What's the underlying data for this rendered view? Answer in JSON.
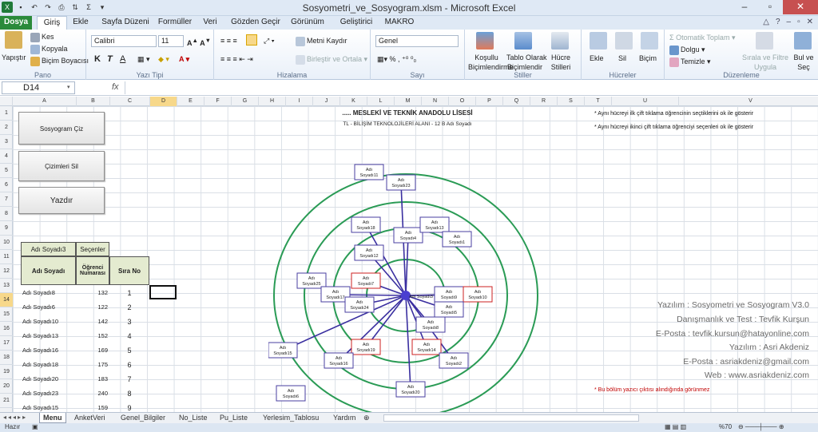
{
  "window": {
    "title": "Sosyometri_ve_Sosyogram.xlsm - Microsoft Excel"
  },
  "ribbon_tabs": [
    "Dosya",
    "Giriş",
    "Ekle",
    "Sayfa Düzeni",
    "Formüller",
    "Veri",
    "Gözden Geçir",
    "Görünüm",
    "Geliştirici",
    "MAKRO"
  ],
  "ribbon": {
    "pano": {
      "label": "Pano",
      "yapistir": "Yapıştır",
      "kes": "Kes",
      "kopyala": "Kopyala",
      "bicim_boyacisi": "Biçim Boyacısı"
    },
    "yazi_tipi": {
      "label": "Yazı Tipi",
      "font": "Calibri",
      "size": "11",
      "bold": "K",
      "italic": "T",
      "underline": "A"
    },
    "hizalama": {
      "label": "Hizalama",
      "metni_kaydir": "Metni Kaydır",
      "birlestir": "Birleştir ve Ortala"
    },
    "sayi": {
      "label": "Sayı",
      "format": "Genel"
    },
    "stiller": {
      "label": "Stiller",
      "kosullu": "Koşullu",
      "kosullu2": "Biçimlendirme",
      "tablo": "Tablo Olarak",
      "tablo2": "Biçimlendir",
      "hucre": "Hücre",
      "hucre2": "Stilleri"
    },
    "hucreler": {
      "label": "Hücreler",
      "ekle": "Ekle",
      "sil": "Sil",
      "bicim": "Biçim"
    },
    "duzenleme": {
      "label": "Düzenleme",
      "otomatik_toplam": "Otomatik Toplam",
      "dolgu": "Dolgu",
      "temizle": "Temizle",
      "sirala": "Sırala ve Filtre",
      "sirala2": "Uygula",
      "bul": "Bul ve",
      "bul2": "Seç"
    }
  },
  "formula_bar": {
    "name_box": "D14",
    "fx": "fx",
    "value": ""
  },
  "columns": [
    "A",
    "B",
    "C",
    "D",
    "E",
    "F",
    "G",
    "H",
    "I",
    "J",
    "K",
    "L",
    "M",
    "N",
    "O",
    "P",
    "Q",
    "R",
    "S",
    "T",
    "U",
    "V"
  ],
  "rows": [
    "1",
    "2",
    "3",
    "4",
    "5",
    "6",
    "7",
    "8",
    "9",
    "10",
    "11",
    "12",
    "13",
    "14",
    "15",
    "16",
    "17",
    "18",
    "19",
    "20",
    "21",
    "22"
  ],
  "macro_buttons": {
    "draw": "Sosyogram Çiz",
    "clear": "Çizimleri Sil",
    "print": "Yazdır"
  },
  "table": {
    "selected_label": "Adı Soyadı3",
    "choosers_label": "Seçenler",
    "headers": {
      "name": "Adı Soyadı",
      "number": "Öğrenci Numarası",
      "order": "Sıra No"
    },
    "rows": [
      {
        "name": "Adı Soyadı8",
        "number": "132",
        "order": "1"
      },
      {
        "name": "Adı Soyadı6",
        "number": "122",
        "order": "2"
      },
      {
        "name": "Adı Soyadı10",
        "number": "142",
        "order": "3"
      },
      {
        "name": "Adı Soyadı13",
        "number": "152",
        "order": "4"
      },
      {
        "name": "Adı Soyadı16",
        "number": "169",
        "order": "5"
      },
      {
        "name": "Adı Soyadı18",
        "number": "175",
        "order": "6"
      },
      {
        "name": "Adı Soyadı20",
        "number": "183",
        "order": "7"
      },
      {
        "name": "Adı Soyadı23",
        "number": "240",
        "order": "8"
      },
      {
        "name": "Adı Soyadı15",
        "number": "159",
        "order": "9"
      }
    ]
  },
  "sociogram": {
    "title": "..... MESLEKİ VE TEKNİK ANADOLU LİSESİ",
    "subtitle": "TL - BİLİŞİM TEKNOLOJİLERİ ALANI - 12 B  Adı Soyadı",
    "center": "Adı Soyadı3",
    "nodes": [
      "Adı Soyadı11",
      "Adı Soyadı23",
      "Adı Soyadı18",
      "Adı Soyadı4",
      "Adı Soyadı13",
      "Adı Soyadı1",
      "Adı Soyadı12",
      "Adı Soyadı7",
      "Adı Soyadı25",
      "Adı Soyadı17",
      "Adı Soyadı24",
      "Adı Soyadı9",
      "Adı Soyadı10",
      "Adı Soyadı5",
      "Adı Soyadı8",
      "Adı Soyadı19",
      "Adı Soyadı14",
      "Adı Soyadı15",
      "Adı Soyadı16",
      "Adı Soyadı2",
      "Adı Soyadı20",
      "Adı Soyadı6",
      "Adı Soyadı21",
      "Adı Soyadı22",
      "Adı Soyadı"
    ],
    "ring_color": "#2a9b55",
    "line_color": "#3a2fa0"
  },
  "notes": {
    "n1": "* Aynı hücreyi ilk çift tıklama öğrencinin seçtiklerini ok ile gösterir",
    "n2": "* Aynı hücreyi ikinci çift tıklama öğrenciyi seçenleri ok ile gösterir",
    "print_note": "* Bu bölüm yazıcı çıktısı alındığında görünmez"
  },
  "credits": {
    "l1": "Yazılım : Sosyometri ve Sosyogram V3.0",
    "l2": "Danışmanlık ve Test : Tevfik Kurşun",
    "l3": "E-Posta : tevfik.kursun@hatayonline.com",
    "l4": "Yazılım : Asri Akdeniz",
    "l5": "E-Posta : asriakdeniz@gmail.com",
    "l6": "Web : www.asriakdeniz.com"
  },
  "sheet_tabs": [
    "Menu",
    "AnketVeri",
    "Genel_Bilgiler",
    "No_Liste",
    "Pu_Liste",
    "Yerlesim_Tablosu",
    "Yardım"
  ],
  "status": {
    "ready": "Hazır",
    "zoom": "%70"
  }
}
